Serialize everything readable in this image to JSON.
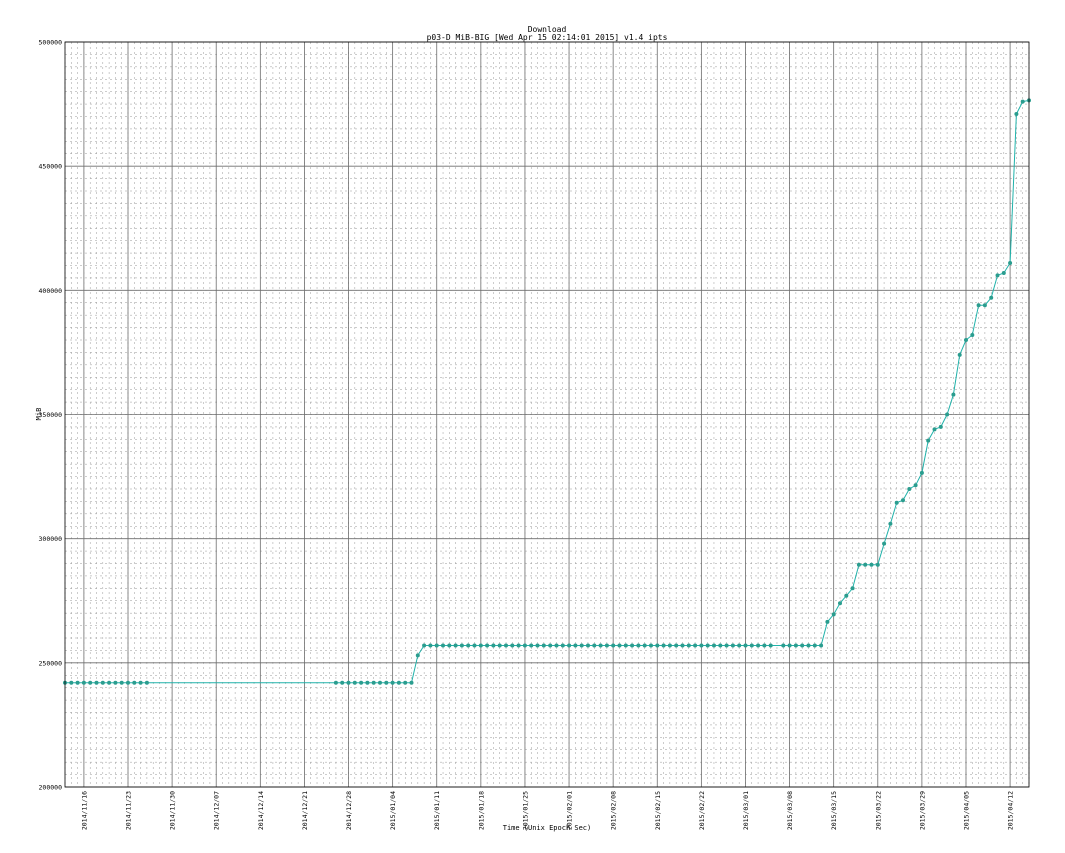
{
  "chart_data": {
    "type": "line",
    "title": "Download",
    "subtitle": "p03-D MiB-BIG [Wed Apr 15 02:14:01 2015] v1.4 ipts",
    "xlabel": "Time (Unix Epoch Sec)",
    "ylabel": "MiB",
    "ylim": [
      200000,
      500000
    ],
    "xlim": [
      "2014-11-13",
      "2015-04-15"
    ],
    "grid": true,
    "yticks": [
      "200000",
      "250000",
      "300000",
      "350000",
      "400000",
      "450000",
      "500000"
    ],
    "xticks": [
      "2014/11/16",
      "2014/11/23",
      "2014/11/30",
      "2014/12/07",
      "2014/12/14",
      "2014/12/21",
      "2014/12/28",
      "2015/01/04",
      "2015/01/11",
      "2015/01/18",
      "2015/01/25",
      "2015/02/01",
      "2015/02/08",
      "2015/02/15",
      "2015/02/22",
      "2015/03/01",
      "2015/03/08",
      "2015/03/15",
      "2015/03/22",
      "2015/03/29",
      "2015/04/05",
      "2015/04/12"
    ],
    "series": [
      {
        "color": "#20b2aa",
        "marker_color": "#2a9d8f",
        "segments": [
          {
            "x": [
              "2014-11-13",
              "2014-11-14",
              "2014-11-15",
              "2014-11-16",
              "2014-11-17",
              "2014-11-18",
              "2014-11-19",
              "2014-11-20",
              "2014-11-21",
              "2014-11-22",
              "2014-11-23",
              "2014-11-24",
              "2014-11-25",
              "2014-11-26"
            ],
            "y": [
              242000,
              242000,
              242000,
              242000,
              242000,
              242000,
              242000,
              242000,
              242000,
              242000,
              242000,
              242000,
              242000,
              242000
            ]
          },
          {
            "x": [
              "2014-12-26",
              "2014-12-27",
              "2014-12-28",
              "2014-12-29",
              "2014-12-30",
              "2014-12-31",
              "2015-01-01",
              "2015-01-02",
              "2015-01-03",
              "2015-01-04",
              "2015-01-05",
              "2015-01-06",
              "2015-01-07",
              "2015-01-08",
              "2015-01-09",
              "2015-01-10",
              "2015-01-11",
              "2015-01-12",
              "2015-01-13",
              "2015-01-14",
              "2015-01-15",
              "2015-01-16",
              "2015-01-17",
              "2015-01-18",
              "2015-01-19",
              "2015-01-20",
              "2015-01-21",
              "2015-01-22",
              "2015-01-23",
              "2015-01-24",
              "2015-01-25",
              "2015-01-26",
              "2015-01-27",
              "2015-01-28",
              "2015-01-29",
              "2015-01-30",
              "2015-01-31",
              "2015-02-01",
              "2015-02-02",
              "2015-02-03",
              "2015-02-04",
              "2015-02-05",
              "2015-02-06",
              "2015-02-07",
              "2015-02-08",
              "2015-02-09",
              "2015-02-10",
              "2015-02-11",
              "2015-02-12",
              "2015-02-13",
              "2015-02-14",
              "2015-02-15",
              "2015-02-16",
              "2015-02-17",
              "2015-02-18",
              "2015-02-19",
              "2015-02-20",
              "2015-02-21",
              "2015-02-22",
              "2015-02-23",
              "2015-02-24",
              "2015-02-25",
              "2015-02-26",
              "2015-02-27",
              "2015-02-28",
              "2015-03-01",
              "2015-03-02",
              "2015-03-03",
              "2015-03-04",
              "2015-03-05"
            ],
            "y": [
              242000,
              242000,
              242000,
              242000,
              242000,
              242000,
              242000,
              242000,
              242000,
              242000,
              242000,
              242000,
              242000,
              253000,
              257000,
              257000,
              257000,
              257000,
              257000,
              257000,
              257000,
              257000,
              257000,
              257000,
              257000,
              257000,
              257000,
              257000,
              257000,
              257000,
              257000,
              257000,
              257000,
              257000,
              257000,
              257000,
              257000,
              257000,
              257000,
              257000,
              257000,
              257000,
              257000,
              257000,
              257000,
              257000,
              257000,
              257000,
              257000,
              257000,
              257000,
              257000,
              257000,
              257000,
              257000,
              257000,
              257000,
              257000,
              257000,
              257000,
              257000,
              257000,
              257000,
              257000,
              257000,
              257000,
              257000,
              257000,
              257000,
              257000
            ]
          },
          {
            "x": [
              "2015-03-07",
              "2015-03-08",
              "2015-03-09",
              "2015-03-10",
              "2015-03-11",
              "2015-03-12",
              "2015-03-13",
              "2015-03-14",
              "2015-03-15",
              "2015-03-16",
              "2015-03-17",
              "2015-03-18",
              "2015-03-19",
              "2015-03-20",
              "2015-03-21",
              "2015-03-22",
              "2015-03-23",
              "2015-03-24",
              "2015-03-25",
              "2015-03-26",
              "2015-03-27",
              "2015-03-28",
              "2015-03-29",
              "2015-03-30",
              "2015-03-31",
              "2015-04-01",
              "2015-04-02",
              "2015-04-03",
              "2015-04-04",
              "2015-04-05",
              "2015-04-06",
              "2015-04-07",
              "2015-04-08",
              "2015-04-09",
              "2015-04-10",
              "2015-04-11",
              "2015-04-12",
              "2015-04-13",
              "2015-04-14",
              "2015-04-15"
            ],
            "y": [
              257000,
              257000,
              257000,
              257000,
              257000,
              257000,
              257000,
              266500,
              269500,
              274000,
              277000,
              280000,
              289500,
              289500,
              289500,
              289500,
              298000,
              306000,
              314500,
              315500,
              320000,
              321500,
              326500,
              339500,
              344000,
              345000,
              350000,
              358000,
              374000,
              380000,
              382000,
              394000,
              394000,
              397000,
              406000,
              407000,
              411000,
              471000,
              476000,
              476500
            ]
          }
        ]
      }
    ]
  }
}
